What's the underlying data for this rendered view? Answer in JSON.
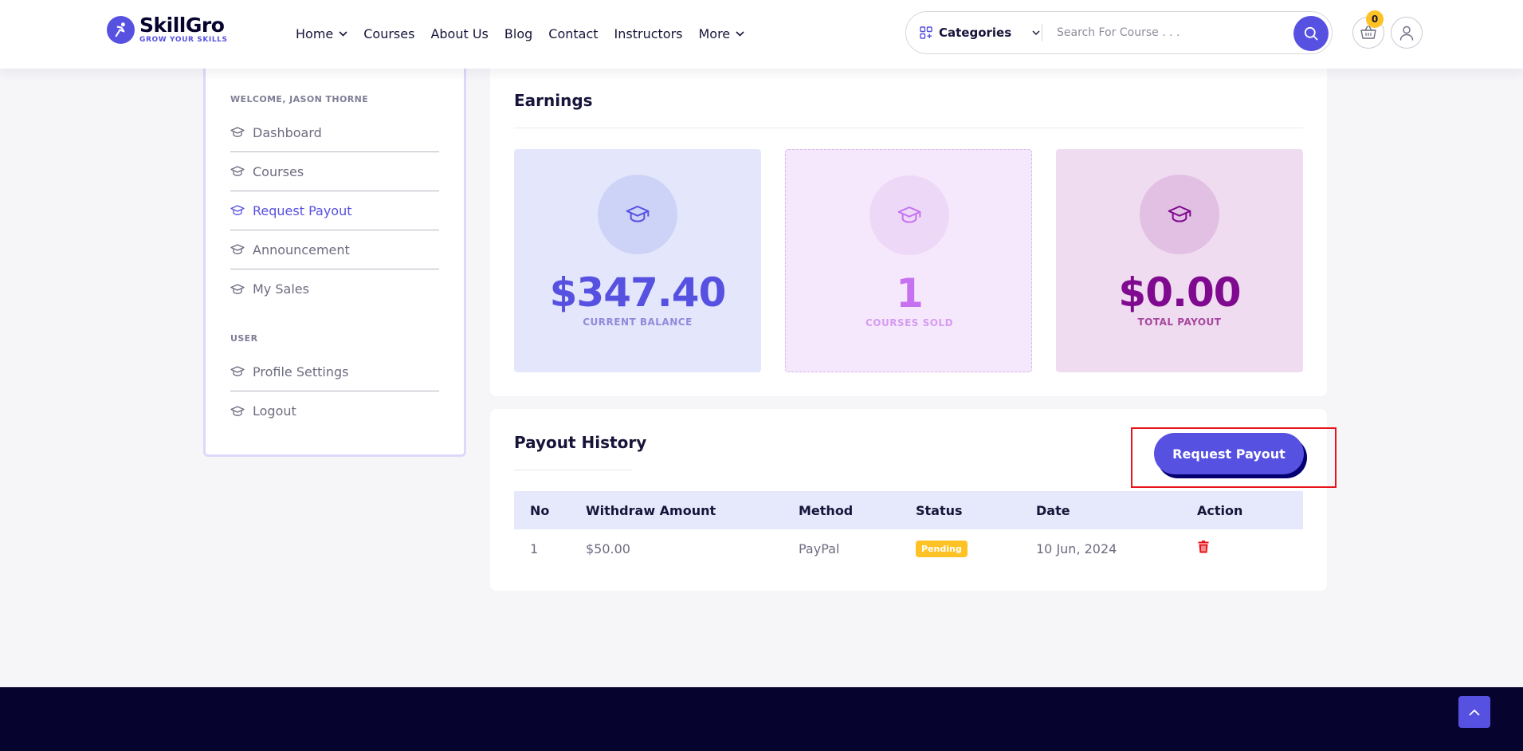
{
  "brand": {
    "name": "SkillGro",
    "tagline": "GROW YOUR SKILLS"
  },
  "nav": {
    "items": [
      {
        "label": "Home",
        "has_dropdown": true
      },
      {
        "label": "Courses",
        "has_dropdown": false
      },
      {
        "label": "About Us",
        "has_dropdown": false
      },
      {
        "label": "Blog",
        "has_dropdown": false
      },
      {
        "label": "Contact",
        "has_dropdown": false
      },
      {
        "label": "Instructors",
        "has_dropdown": false
      },
      {
        "label": "More",
        "has_dropdown": true
      }
    ]
  },
  "search": {
    "category_label": "Categories",
    "placeholder": "Search For Course . . ."
  },
  "cart": {
    "count": "0"
  },
  "sidebar": {
    "welcome": "WELCOME, JASON THORNE",
    "main_items": [
      {
        "label": "Dashboard",
        "active": false
      },
      {
        "label": "Courses",
        "active": false
      },
      {
        "label": "Request Payout",
        "active": true
      },
      {
        "label": "Announcement",
        "active": false
      },
      {
        "label": "My Sales",
        "active": false
      }
    ],
    "user_heading": "USER",
    "user_items": [
      {
        "label": "Profile Settings"
      },
      {
        "label": "Logout"
      }
    ]
  },
  "earnings": {
    "title": "Earnings",
    "stats": [
      {
        "value": "$347.40",
        "label": "CURRENT BALANCE",
        "color": "#5751e1"
      },
      {
        "value": "1",
        "label": "COURSES SOLD",
        "color": "#c672f0"
      },
      {
        "value": "$0.00",
        "label": "TOTAL PAYOUT",
        "color": "#7f0a8f"
      }
    ]
  },
  "payout_history": {
    "title": "Payout History",
    "request_button": "Request Payout",
    "columns": [
      "No",
      "Withdraw Amount",
      "Method",
      "Status",
      "Date",
      "Action"
    ],
    "rows": [
      {
        "no": "1",
        "amount": "$50.00",
        "method": "PayPal",
        "status": "Pending",
        "date": "10 Jun, 2024",
        "action_icon": "trash-icon"
      }
    ]
  },
  "colors": {
    "accent": "#5751e1",
    "navy": "#06042e",
    "pending": "#ffc224",
    "delete": "#e8141b",
    "highlight": "#e8141b"
  }
}
